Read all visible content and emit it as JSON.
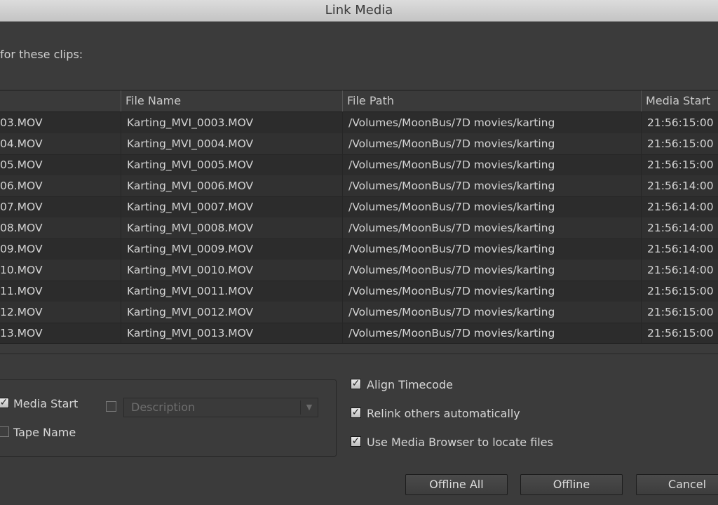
{
  "window": {
    "title": "Link Media"
  },
  "prompt": "for these clips:",
  "table": {
    "headers": [
      "",
      "File Name",
      "File Path",
      "Media Start"
    ],
    "rows": [
      {
        "clip": "03.MOV",
        "file": "Karting_MVI_0003.MOV",
        "path": "/Volumes/MoonBus/7D movies/karting",
        "start": "21:56:15:00"
      },
      {
        "clip": "04.MOV",
        "file": "Karting_MVI_0004.MOV",
        "path": "/Volumes/MoonBus/7D movies/karting",
        "start": "21:56:15:00"
      },
      {
        "clip": "05.MOV",
        "file": "Karting_MVI_0005.MOV",
        "path": "/Volumes/MoonBus/7D movies/karting",
        "start": "21:56:15:00"
      },
      {
        "clip": "06.MOV",
        "file": "Karting_MVI_0006.MOV",
        "path": "/Volumes/MoonBus/7D movies/karting",
        "start": "21:56:14:00"
      },
      {
        "clip": "07.MOV",
        "file": "Karting_MVI_0007.MOV",
        "path": "/Volumes/MoonBus/7D movies/karting",
        "start": "21:56:14:00"
      },
      {
        "clip": "08.MOV",
        "file": "Karting_MVI_0008.MOV",
        "path": "/Volumes/MoonBus/7D movies/karting",
        "start": "21:56:14:00"
      },
      {
        "clip": "09.MOV",
        "file": "Karting_MVI_0009.MOV",
        "path": "/Volumes/MoonBus/7D movies/karting",
        "start": "21:56:14:00"
      },
      {
        "clip": "10.MOV",
        "file": "Karting_MVI_0010.MOV",
        "path": "/Volumes/MoonBus/7D movies/karting",
        "start": "21:56:14:00"
      },
      {
        "clip": "11.MOV",
        "file": "Karting_MVI_0011.MOV",
        "path": "/Volumes/MoonBus/7D movies/karting",
        "start": "21:56:15:00"
      },
      {
        "clip": "12.MOV",
        "file": "Karting_MVI_0012.MOV",
        "path": "/Volumes/MoonBus/7D movies/karting",
        "start": "21:56:15:00"
      },
      {
        "clip": "13.MOV",
        "file": "Karting_MVI_0013.MOV",
        "path": "/Volumes/MoonBus/7D movies/karting",
        "start": "21:56:15:00"
      }
    ]
  },
  "match_options": {
    "media_start": {
      "label": "Media Start",
      "checked": true
    },
    "tape_name": {
      "label": "Tape Name",
      "checked": false
    },
    "description": {
      "checked": false,
      "placeholder": "Description"
    }
  },
  "options": {
    "align_timecode": {
      "label": "Align Timecode",
      "checked": true
    },
    "relink_others": {
      "label": "Relink others automatically",
      "checked": true
    },
    "use_media_browser": {
      "label": "Use Media Browser to locate files",
      "checked": true
    }
  },
  "buttons": {
    "offline_all": "Offline All",
    "offline": "Offline",
    "cancel": "Cancel"
  },
  "glyphs": {
    "check": "✓",
    "dropdown_arrow": "▼"
  },
  "colors": {
    "background": "#3b3b3b",
    "table_bg": "#2c2c2c",
    "text": "#d8d8d8"
  }
}
